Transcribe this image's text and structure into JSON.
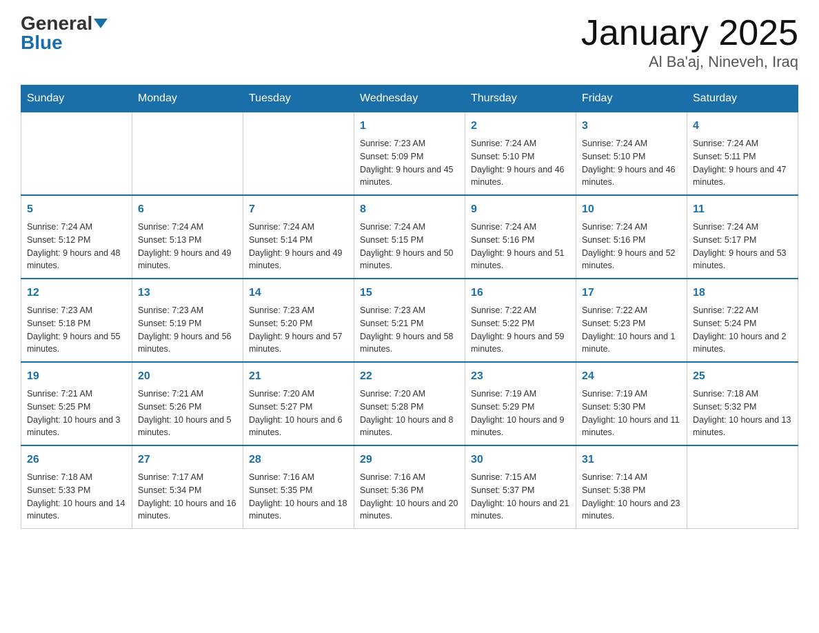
{
  "header": {
    "logo_general": "General",
    "logo_blue": "Blue",
    "month_title": "January 2025",
    "location": "Al Ba'aj, Nineveh, Iraq"
  },
  "days_of_week": [
    "Sunday",
    "Monday",
    "Tuesday",
    "Wednesday",
    "Thursday",
    "Friday",
    "Saturday"
  ],
  "weeks": [
    [
      {
        "day": "",
        "info": ""
      },
      {
        "day": "",
        "info": ""
      },
      {
        "day": "",
        "info": ""
      },
      {
        "day": "1",
        "info": "Sunrise: 7:23 AM\nSunset: 5:09 PM\nDaylight: 9 hours and 45 minutes."
      },
      {
        "day": "2",
        "info": "Sunrise: 7:24 AM\nSunset: 5:10 PM\nDaylight: 9 hours and 46 minutes."
      },
      {
        "day": "3",
        "info": "Sunrise: 7:24 AM\nSunset: 5:10 PM\nDaylight: 9 hours and 46 minutes."
      },
      {
        "day": "4",
        "info": "Sunrise: 7:24 AM\nSunset: 5:11 PM\nDaylight: 9 hours and 47 minutes."
      }
    ],
    [
      {
        "day": "5",
        "info": "Sunrise: 7:24 AM\nSunset: 5:12 PM\nDaylight: 9 hours and 48 minutes."
      },
      {
        "day": "6",
        "info": "Sunrise: 7:24 AM\nSunset: 5:13 PM\nDaylight: 9 hours and 49 minutes."
      },
      {
        "day": "7",
        "info": "Sunrise: 7:24 AM\nSunset: 5:14 PM\nDaylight: 9 hours and 49 minutes."
      },
      {
        "day": "8",
        "info": "Sunrise: 7:24 AM\nSunset: 5:15 PM\nDaylight: 9 hours and 50 minutes."
      },
      {
        "day": "9",
        "info": "Sunrise: 7:24 AM\nSunset: 5:16 PM\nDaylight: 9 hours and 51 minutes."
      },
      {
        "day": "10",
        "info": "Sunrise: 7:24 AM\nSunset: 5:16 PM\nDaylight: 9 hours and 52 minutes."
      },
      {
        "day": "11",
        "info": "Sunrise: 7:24 AM\nSunset: 5:17 PM\nDaylight: 9 hours and 53 minutes."
      }
    ],
    [
      {
        "day": "12",
        "info": "Sunrise: 7:23 AM\nSunset: 5:18 PM\nDaylight: 9 hours and 55 minutes."
      },
      {
        "day": "13",
        "info": "Sunrise: 7:23 AM\nSunset: 5:19 PM\nDaylight: 9 hours and 56 minutes."
      },
      {
        "day": "14",
        "info": "Sunrise: 7:23 AM\nSunset: 5:20 PM\nDaylight: 9 hours and 57 minutes."
      },
      {
        "day": "15",
        "info": "Sunrise: 7:23 AM\nSunset: 5:21 PM\nDaylight: 9 hours and 58 minutes."
      },
      {
        "day": "16",
        "info": "Sunrise: 7:22 AM\nSunset: 5:22 PM\nDaylight: 9 hours and 59 minutes."
      },
      {
        "day": "17",
        "info": "Sunrise: 7:22 AM\nSunset: 5:23 PM\nDaylight: 10 hours and 1 minute."
      },
      {
        "day": "18",
        "info": "Sunrise: 7:22 AM\nSunset: 5:24 PM\nDaylight: 10 hours and 2 minutes."
      }
    ],
    [
      {
        "day": "19",
        "info": "Sunrise: 7:21 AM\nSunset: 5:25 PM\nDaylight: 10 hours and 3 minutes."
      },
      {
        "day": "20",
        "info": "Sunrise: 7:21 AM\nSunset: 5:26 PM\nDaylight: 10 hours and 5 minutes."
      },
      {
        "day": "21",
        "info": "Sunrise: 7:20 AM\nSunset: 5:27 PM\nDaylight: 10 hours and 6 minutes."
      },
      {
        "day": "22",
        "info": "Sunrise: 7:20 AM\nSunset: 5:28 PM\nDaylight: 10 hours and 8 minutes."
      },
      {
        "day": "23",
        "info": "Sunrise: 7:19 AM\nSunset: 5:29 PM\nDaylight: 10 hours and 9 minutes."
      },
      {
        "day": "24",
        "info": "Sunrise: 7:19 AM\nSunset: 5:30 PM\nDaylight: 10 hours and 11 minutes."
      },
      {
        "day": "25",
        "info": "Sunrise: 7:18 AM\nSunset: 5:32 PM\nDaylight: 10 hours and 13 minutes."
      }
    ],
    [
      {
        "day": "26",
        "info": "Sunrise: 7:18 AM\nSunset: 5:33 PM\nDaylight: 10 hours and 14 minutes."
      },
      {
        "day": "27",
        "info": "Sunrise: 7:17 AM\nSunset: 5:34 PM\nDaylight: 10 hours and 16 minutes."
      },
      {
        "day": "28",
        "info": "Sunrise: 7:16 AM\nSunset: 5:35 PM\nDaylight: 10 hours and 18 minutes."
      },
      {
        "day": "29",
        "info": "Sunrise: 7:16 AM\nSunset: 5:36 PM\nDaylight: 10 hours and 20 minutes."
      },
      {
        "day": "30",
        "info": "Sunrise: 7:15 AM\nSunset: 5:37 PM\nDaylight: 10 hours and 21 minutes."
      },
      {
        "day": "31",
        "info": "Sunrise: 7:14 AM\nSunset: 5:38 PM\nDaylight: 10 hours and 23 minutes."
      },
      {
        "day": "",
        "info": ""
      }
    ]
  ]
}
